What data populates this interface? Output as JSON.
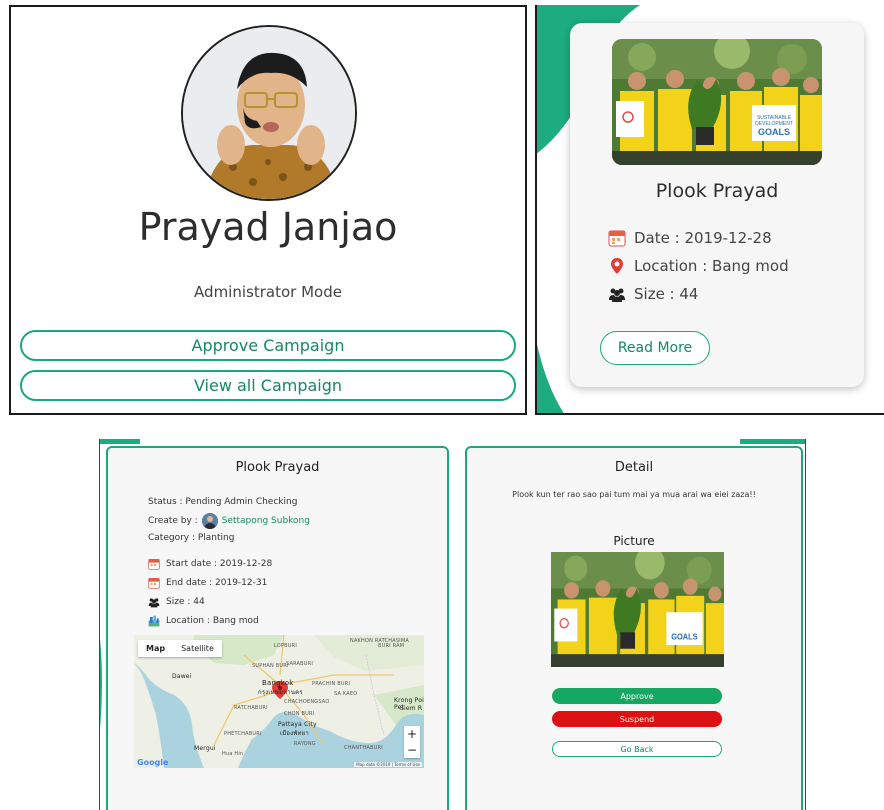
{
  "profile": {
    "name": "Prayad Janjao",
    "mode": "Administrator Mode",
    "approve_label": "Approve Campaign",
    "view_label": "View all Campaign"
  },
  "campaign_card": {
    "title": "Plook Prayad",
    "date": "Date : 2019-12-28",
    "location": "Location : Bang mod",
    "size": "Size : 44",
    "read_more": "Read More",
    "photo_sign_right": "SUSTAINABLE DEVELOPMENT GOALS"
  },
  "review": {
    "left": {
      "title": "Plook Prayad",
      "status": "Status : Pending Admin Checking",
      "create_by_label": "Create by :",
      "creator": "Settapong Subkong",
      "category": "Category : Planting",
      "start_date": "Start date : 2019-12-28",
      "end_date": "End date : 2019-12-31",
      "size": "Size : 44",
      "location": "Location : Bang mod",
      "map": {
        "type_map": "Map",
        "type_satellite": "Satellite",
        "zoom_in": "+",
        "zoom_out": "−",
        "google": "Google",
        "footer": "Map data ©2019 | Terms of Use",
        "labels": {
          "nakhon": "NAKHON RATCHASIMA",
          "lopburi": "LOPBURI",
          "suphan": "SUPHAN BURI",
          "saraburi": "SARABURI",
          "buriram": "BURI RAM",
          "prachin": "PRACHIN BURI",
          "sakaeo": "SA KAEO",
          "bangkok": "Bangkok",
          "bangkok_th": "กรุงเทพมหานคร",
          "chachoengsao": "CHACHOENGSAO",
          "ratchaburi": "RATCHABURI",
          "chonburi": "CHON BURI",
          "phetchaburi": "PHETCHABURI",
          "pattaya": "Pattaya City",
          "pattaya_th": "เมืองพัทยา",
          "rayong": "RAYONG",
          "chanthaburi": "CHANTHABURI",
          "krong": "Krong Poi Pet",
          "siem": "Siem R",
          "hua_hin": "Hua Hin",
          "dawei": "Dawei",
          "mergui": "Mergui"
        }
      }
    },
    "right": {
      "title": "Detail",
      "description": "Plook kun ter rao sao pai tum mai ya mua arai wa eiei zaza!!",
      "picture_title": "Picture",
      "approve": "Approve",
      "suspend": "Suspend",
      "go_back": "Go Back"
    }
  },
  "colors": {
    "accent": "#19a97a",
    "approve": "#15a862",
    "suspend": "#dd1111"
  },
  "icons": [
    "calendar-icon",
    "location-pin-icon",
    "users-icon",
    "map-icon"
  ]
}
